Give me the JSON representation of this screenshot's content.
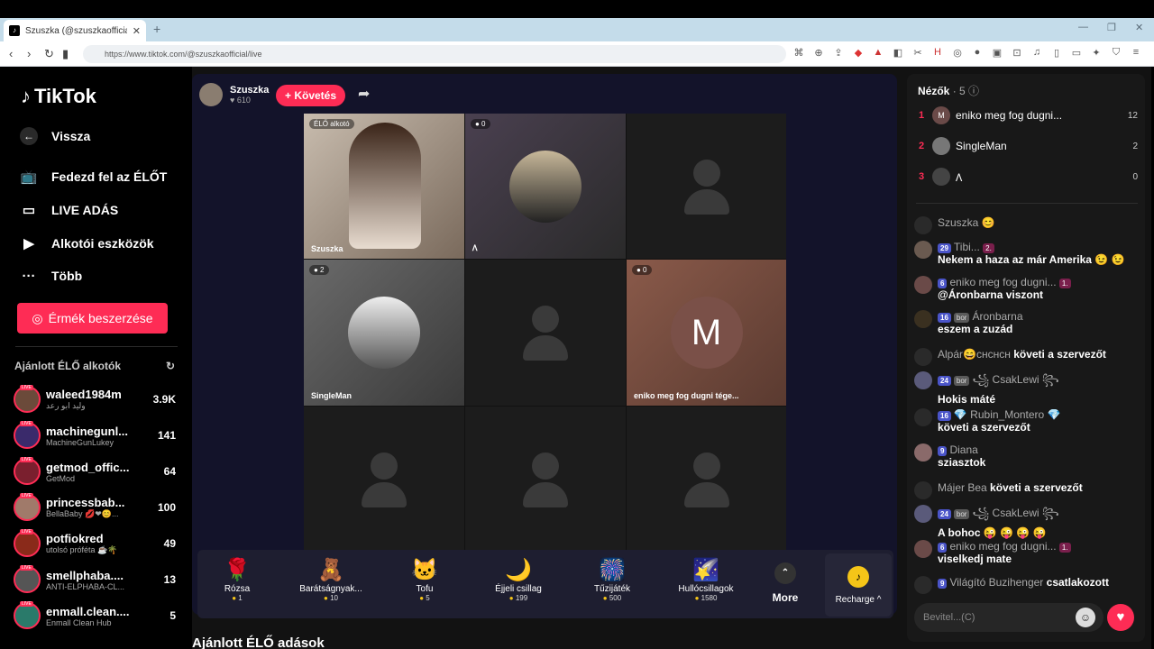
{
  "browser": {
    "tab_title": "Szuszka (@szuszkaofficial) ÉL...",
    "url": "https://www.tiktok.com/@szuszkaofficial/live"
  },
  "sidebar": {
    "logo": "TikTok",
    "nav": [
      {
        "label": "Vissza",
        "icon": "arrow-left-icon"
      },
      {
        "label": "Fedezd fel az ÉLŐT",
        "icon": "live-tv-icon"
      },
      {
        "label": "LIVE ADÁS",
        "icon": "video-camera-icon"
      },
      {
        "label": "Alkotói eszközök",
        "icon": "creator-tools-icon"
      },
      {
        "label": "Több",
        "icon": "more-dots-icon"
      }
    ],
    "coins_button": "Érmék beszerzése",
    "recommended_title": "Ajánlott ÉLŐ alkotók",
    "creators": [
      {
        "name": "waleed1984m",
        "sub": "وليد ابو رعد",
        "viewers": "3.9K"
      },
      {
        "name": "machinegunl...",
        "sub": "MachineGunLukey",
        "viewers": "141"
      },
      {
        "name": "getmod_offic...",
        "sub": "GetMod",
        "viewers": "64"
      },
      {
        "name": "princessbab...",
        "sub": "BellaBaby 💋❤😊...",
        "viewers": "100"
      },
      {
        "name": "potfiokred",
        "sub": "utolsó próféta ☕🌴",
        "viewers": "49"
      },
      {
        "name": "smellphaba....",
        "sub": "ANTI-ELPHABA-CL...",
        "viewers": "13"
      },
      {
        "name": "enmall.clean....",
        "sub": "Enmall Clean Hub",
        "viewers": "5"
      }
    ]
  },
  "stream": {
    "host_name": "Szuszka",
    "host_likes": "♥ 610",
    "follow_label": "+ Követés",
    "cells": [
      {
        "badge": "ÉLŐ alkotó",
        "name": "Szuszka"
      },
      {
        "badge": "● 0",
        "name": "𐒰"
      },
      {
        "badge": "",
        "name": ""
      },
      {
        "badge": "● 2",
        "name": "SingleMan"
      },
      {
        "badge": "",
        "name": ""
      },
      {
        "badge": "● 0",
        "name": "eniko meg fog dugni tége...",
        "letter": "M"
      },
      {
        "badge": "",
        "name": ""
      },
      {
        "badge": "",
        "name": ""
      },
      {
        "badge": "",
        "name": ""
      }
    ],
    "suggested_title": "Ajánlott ÉLŐ adások"
  },
  "gifts": [
    {
      "name": "Rózsa",
      "price": "1",
      "icon": "🌹"
    },
    {
      "name": "Barátságnyak...",
      "price": "10",
      "icon": "🧸"
    },
    {
      "name": "Tofu",
      "price": "5",
      "icon": "🐱"
    },
    {
      "name": "Éjjeli csillag",
      "price": "199",
      "icon": "🌙"
    },
    {
      "name": "Tűzijáték",
      "price": "500",
      "icon": "🎆"
    },
    {
      "name": "Hullócsillagok",
      "price": "1580",
      "icon": "🌠"
    }
  ],
  "more_label": "More",
  "recharge_label": "Recharge ^",
  "viewers": {
    "title": "Nézők",
    "count": "· 5",
    "list": [
      {
        "rank": "1",
        "name": "eniko meg fog dugni...",
        "score": "12",
        "initial": "M"
      },
      {
        "rank": "2",
        "name": "SingleMan",
        "score": "2",
        "initial": ""
      },
      {
        "rank": "3",
        "name": "𐒰",
        "score": "0",
        "initial": ""
      }
    ]
  },
  "chat": [
    {
      "user": "Szuszka 😊",
      "text": "",
      "level": "",
      "tag": "",
      "fan": ""
    },
    {
      "user": "Tibi...",
      "text": "Nekem a haza az már Amerika 😉 😉",
      "level": "29",
      "tag": "",
      "fan": "2."
    },
    {
      "user": "eniko meg fog dugni...",
      "text": "@Áronbarna viszont",
      "level": "6",
      "tag": "",
      "fan": "1."
    },
    {
      "user": "Áronbarna",
      "text": "eszem a zuzád",
      "level": "16",
      "tag": "bor",
      "fan": ""
    },
    {
      "user": "Alpár😄ᴄʜᴄʜᴄʜ",
      "text": "követi a szervezőt",
      "level": "",
      "tag": "",
      "fan": ""
    },
    {
      "user": "꧁ CsakLewi ꧂",
      "text": "Hokis máté",
      "level": "24",
      "tag": "bor",
      "fan": ""
    },
    {
      "user": "💎 Rubin_Montero 💎",
      "text": "követi a szervezőt",
      "level": "16",
      "tag": "",
      "fan": ""
    },
    {
      "user": "Diana",
      "text": "sziasztok",
      "level": "9",
      "tag": "",
      "fan": ""
    },
    {
      "user": "Májer Bea",
      "text": "követi a szervezőt",
      "level": "",
      "tag": "",
      "fan": ""
    },
    {
      "user": "꧁ CsakLewi ꧂",
      "text": "A bohoc 😜 😜 😜 😜",
      "level": "24",
      "tag": "bor",
      "fan": ""
    },
    {
      "user": "eniko meg fog dugni...",
      "text": "viselkedj mate",
      "level": "6",
      "tag": "",
      "fan": "1."
    },
    {
      "user": "Világító Buzihenger",
      "text": "csatlakozott",
      "level": "9",
      "tag": "",
      "fan": ""
    }
  ],
  "input_placeholder": "Bevitel...(C)",
  "colors": {
    "accent": "#fe2c55",
    "panel": "#181818",
    "stage": "#13132a"
  }
}
